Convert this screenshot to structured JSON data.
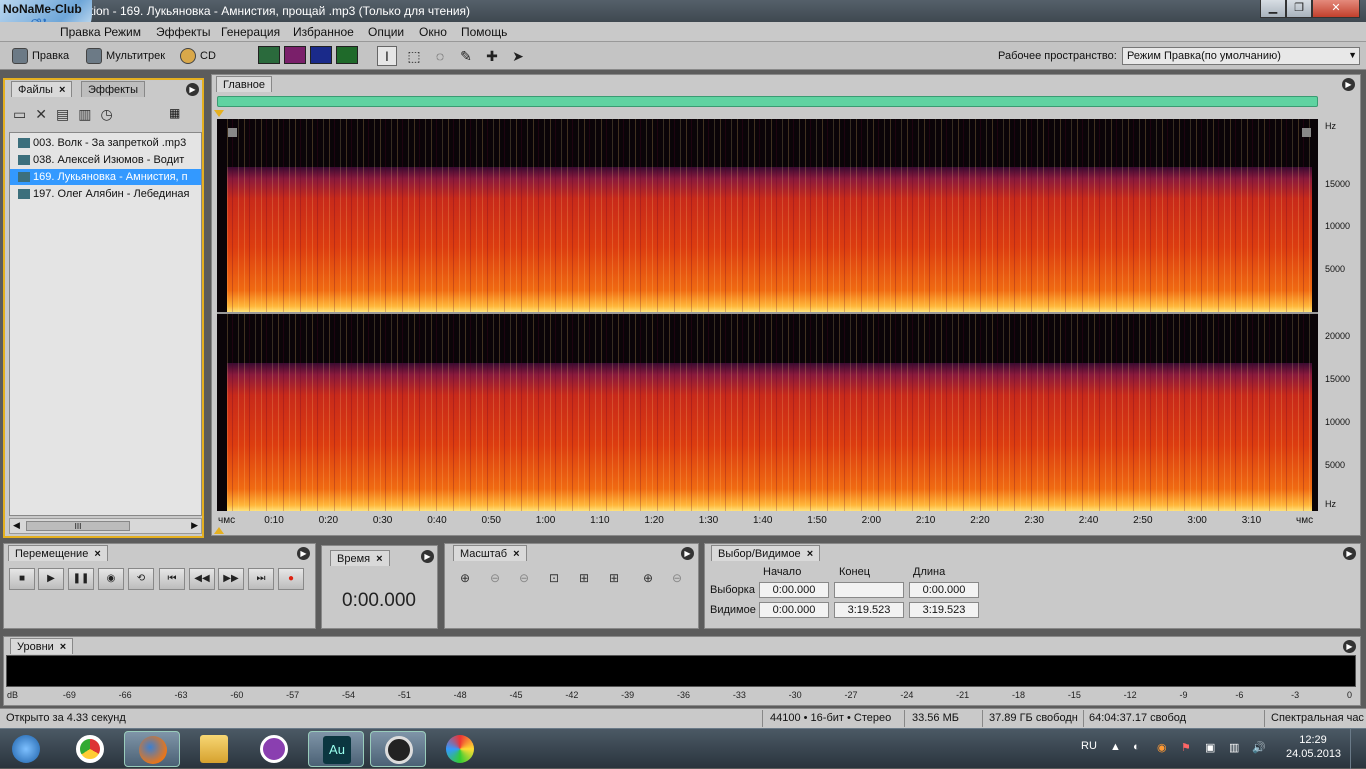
{
  "app": {
    "logo_text": "NoNaMe-Club",
    "title_suffix": "tion - 169. Лукьяновка - Амнистия, прощай .mp3 (Только для чтения)"
  },
  "menu": [
    "Правка",
    "Режим",
    "Эффекты",
    "Генерация",
    "Избранное",
    "Опции",
    "Окно",
    "Помощь"
  ],
  "toolbar": {
    "edit_label": "Правка",
    "multitrack_label": "Мультитрек",
    "cd_label": "CD",
    "workspace_label": "Рабочее пространство:",
    "workspace_value": "Режим Правка(по умолчанию)"
  },
  "files_panel": {
    "tab_files": "Файлы",
    "tab_effects": "Эффекты",
    "items": [
      "003.  Волк - За запреткой .mp3",
      "038.  Алексей Изюмов - Водит",
      "169.  Лукьяновка - Амнистия, п",
      "197.  Олег Алябин - Лебединая"
    ],
    "selected_index": 2,
    "scroll_grip": "III"
  },
  "editor": {
    "tab_label": "Главное",
    "hz_top": [
      "Hz",
      "15000",
      "10000",
      "5000"
    ],
    "hz_bottom": [
      "20000",
      "15000",
      "10000",
      "5000",
      "Hz"
    ],
    "time_labels": [
      "чмс",
      "0:10",
      "0:20",
      "0:30",
      "0:40",
      "0:50",
      "1:00",
      "1:10",
      "1:20",
      "1:30",
      "1:40",
      "1:50",
      "2:00",
      "2:10",
      "2:20",
      "2:30",
      "2:40",
      "2:50",
      "3:00",
      "3:10",
      "чмс"
    ]
  },
  "transport": {
    "tab": "Перемещение"
  },
  "time": {
    "tab": "Время",
    "value": "0:00.000"
  },
  "zoom": {
    "tab": "Масштаб"
  },
  "selection": {
    "tab": "Выбор/Видимое",
    "col_start": "Начало",
    "col_end": "Конец",
    "col_length": "Длина",
    "row_selection": "Выборка",
    "row_visible": "Видимое",
    "sel_start": "0:00.000",
    "sel_end": "",
    "sel_length": "0:00.000",
    "vis_start": "0:00.000",
    "vis_end": "3:19.523",
    "vis_length": "3:19.523"
  },
  "levels": {
    "tab": "Уровни",
    "scale": [
      "dB",
      "-69",
      "-66",
      "-63",
      "-60",
      "-57",
      "-54",
      "-51",
      "-48",
      "-45",
      "-42",
      "-39",
      "-36",
      "-33",
      "-30",
      "-27",
      "-24",
      "-21",
      "-18",
      "-15",
      "-12",
      "-9",
      "-6",
      "-3",
      "0"
    ]
  },
  "status": {
    "opened": "Открыто за 4.33 секунд",
    "format": "44100 • 16-бит • Стерео",
    "size": "33.56 МБ",
    "free": "37.89 ГБ свободн",
    "free_time": "64:04:37.17 свобод",
    "view": "Спектральная час"
  },
  "taskbar": {
    "lang": "RU",
    "time": "12:29",
    "date": "24.05.2013"
  }
}
